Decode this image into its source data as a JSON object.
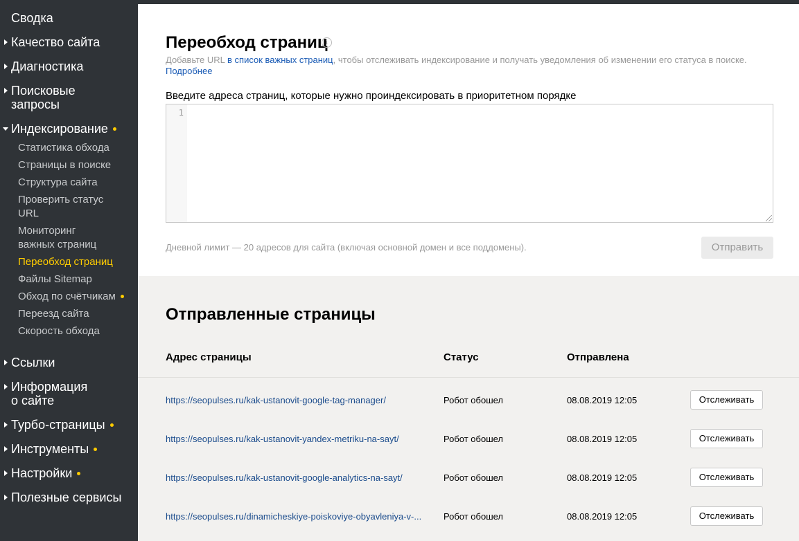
{
  "sidebar": {
    "items": [
      {
        "label": "Сводка"
      },
      {
        "label": "Качество сайта"
      },
      {
        "label": "Диагностика"
      },
      {
        "label": "Поисковые"
      },
      {
        "label": "запросы"
      },
      {
        "label": "Индексирование"
      },
      {
        "label": "Ссылки"
      },
      {
        "label": "Информация"
      },
      {
        "label": "о сайте"
      },
      {
        "label": "Турбо-страницы"
      },
      {
        "label": "Инструменты"
      },
      {
        "label": "Настройки"
      },
      {
        "label": "Полезные сервисы"
      }
    ],
    "sub_items": [
      {
        "label": "Статистика обхода"
      },
      {
        "label": "Страницы в поиске"
      },
      {
        "label": "Структура сайта"
      },
      {
        "label": "Проверить статус"
      },
      {
        "label": "URL"
      },
      {
        "label": "Мониторинг"
      },
      {
        "label": "важных страниц"
      },
      {
        "label": "Переобход страниц"
      },
      {
        "label": "Файлы Sitemap"
      },
      {
        "label": "Обход по счётчикам"
      },
      {
        "label": "Переезд сайта"
      },
      {
        "label": "Скорость обхода"
      }
    ],
    "accent_color": "#ffcc00"
  },
  "recrawl": {
    "title": "Переобход страниц",
    "info_icon": "i",
    "desc_prefix": "Добавьте URL ",
    "desc_link": "в список важных страниц",
    "desc_suffix": ", чтобы отслеживать индексирование и получать уведомления об изменении его статуса в поиске.",
    "more_link": "Подробнее",
    "field_label": "Введите адреса страниц, которые нужно проиндексировать в приоритетном порядке",
    "line_number": "1",
    "limit_note": "Дневной лимит — 20 адресов для сайта (включая основной домен и все поддомены).",
    "submit_label": "Отправить"
  },
  "sent": {
    "title": "Отправленные страницы",
    "columns": [
      "Адрес страницы",
      "Статус",
      "Отправлена"
    ],
    "track_label": "Отслеживать",
    "rows": [
      {
        "url": "https://seopulses.ru/kak-ustanovit-google-tag-manager/",
        "status": "Робот обошел",
        "sent": "08.08.2019 12:05"
      },
      {
        "url": "https://seopulses.ru/kak-ustanovit-yandex-metriku-na-sayt/",
        "status": "Робот обошел",
        "sent": "08.08.2019 12:05"
      },
      {
        "url": "https://seopulses.ru/kak-ustanovit-google-analytics-na-sayt/",
        "status": "Робот обошел",
        "sent": "08.08.2019 12:05"
      },
      {
        "url": "https://seopulses.ru/dinamicheskiye-poiskoviye-obyavleniya-v-...",
        "status": "Робот обошел",
        "sent": "08.08.2019 12:05"
      }
    ]
  }
}
